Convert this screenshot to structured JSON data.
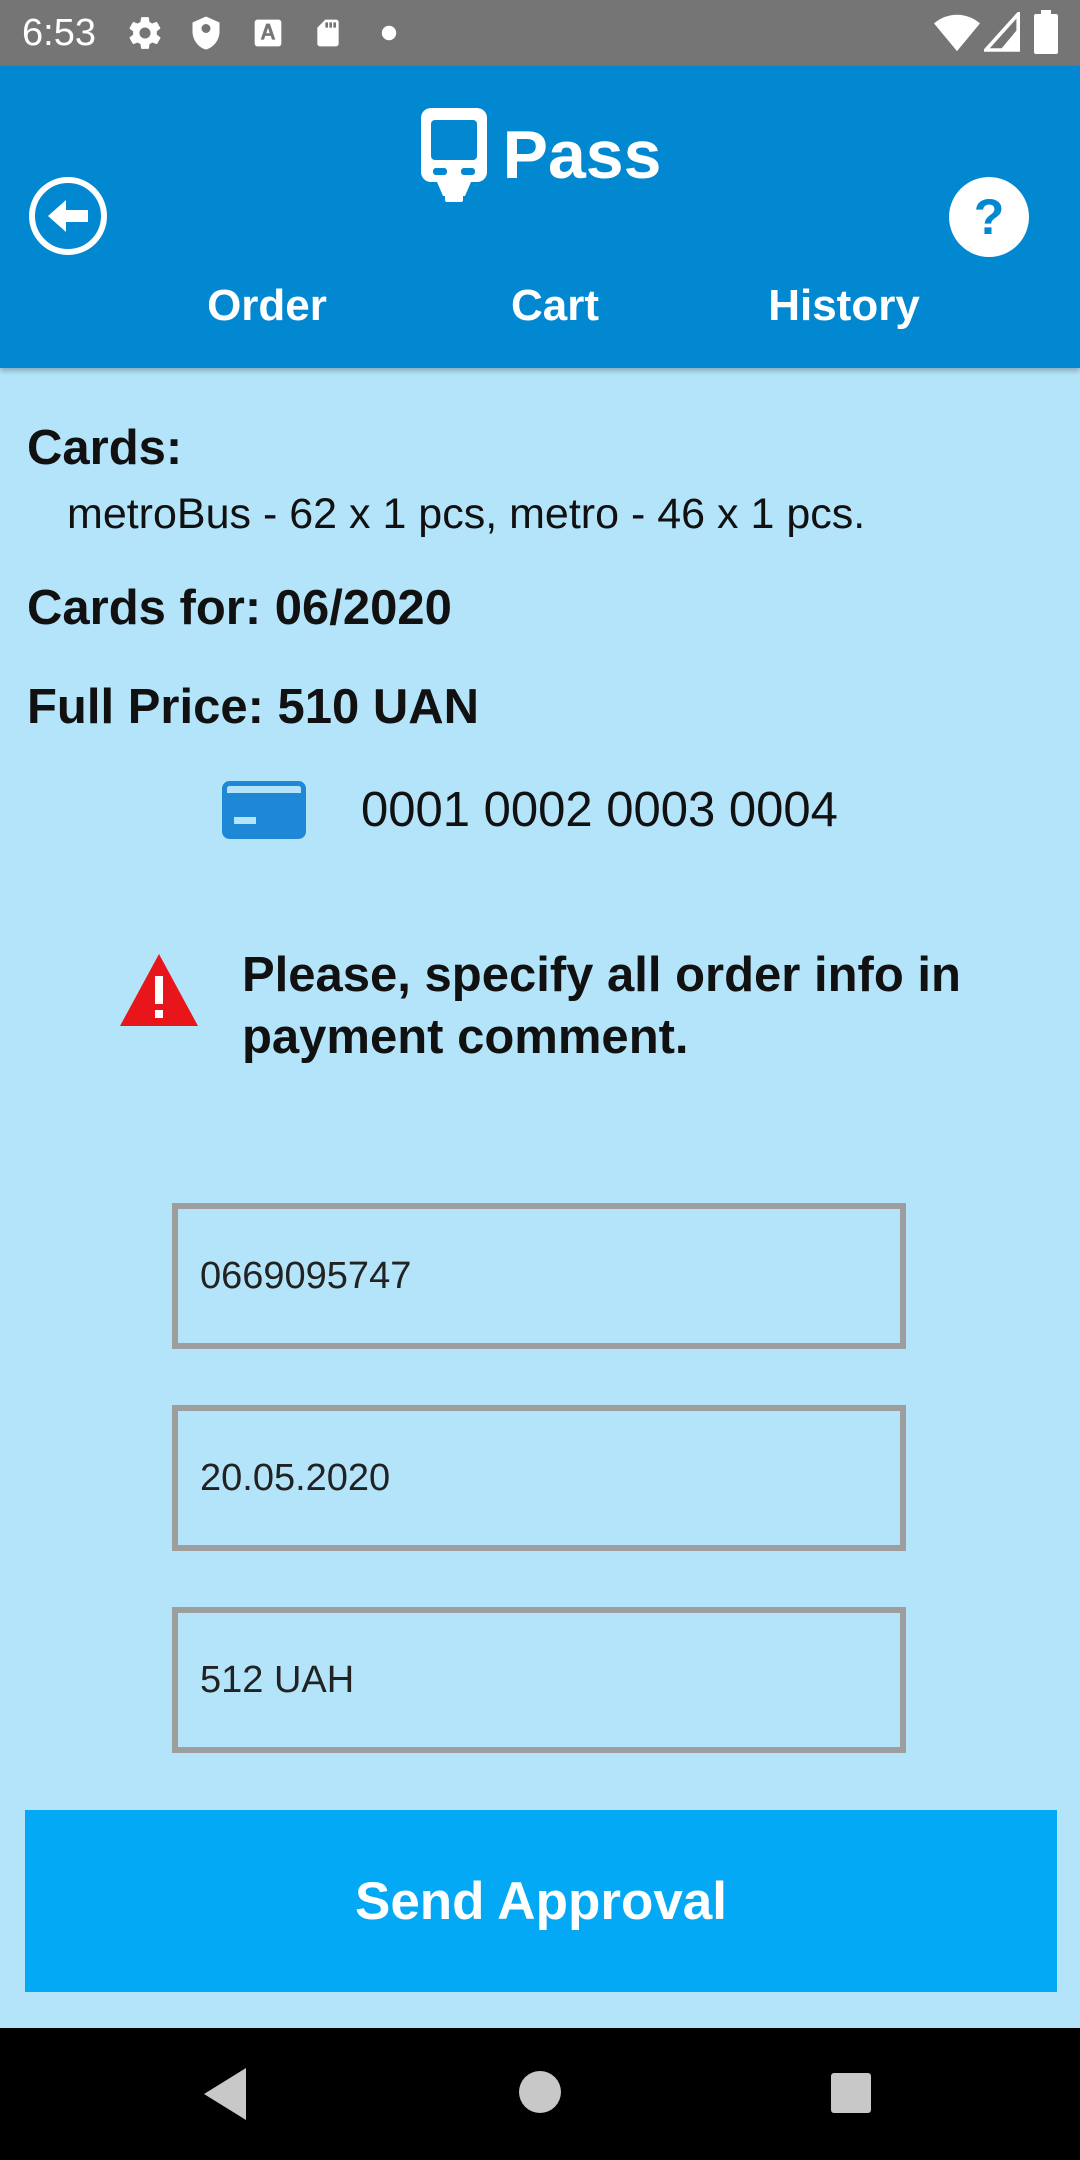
{
  "status_bar": {
    "time": "6:53",
    "left_icons": [
      "gear-icon",
      "shield-icon",
      "a-letter-icon",
      "sd-card-icon",
      "dot-icon"
    ],
    "right_icons": [
      "wifi-icon",
      "signal-icon",
      "battery-icon"
    ]
  },
  "app_bar": {
    "title": "Pass",
    "logo_icon": "bus-icon",
    "back_icon": "back-arrow-circle-icon",
    "help_icon": "question-circle-icon",
    "tabs": [
      {
        "label": "Order"
      },
      {
        "label": "Cart"
      },
      {
        "label": "History"
      }
    ]
  },
  "order": {
    "cards_heading": "Cards:",
    "cards_list": "metroBus - 62 x 1 pcs,  metro - 46 x 1 pcs.",
    "cards_for": "Cards for: 06/2020",
    "full_price": "Full Price: 510 UAN",
    "card_icon": "credit-card-icon",
    "card_number": "0001 0002 0003 0004",
    "warning_icon": "warning-triangle-icon",
    "warning_text": "Please, specify all order info in payment comment."
  },
  "form": {
    "phone_value": "0669095747",
    "date_value": "20.05.2020",
    "amount_value": "512 UAH",
    "send_label": "Send Approval"
  },
  "colors": {
    "app_bar": "#0288d1",
    "background": "#b4e4fa",
    "button": "#03a9f4",
    "warning": "#e8161b",
    "card_icon": "#1e88d6"
  }
}
